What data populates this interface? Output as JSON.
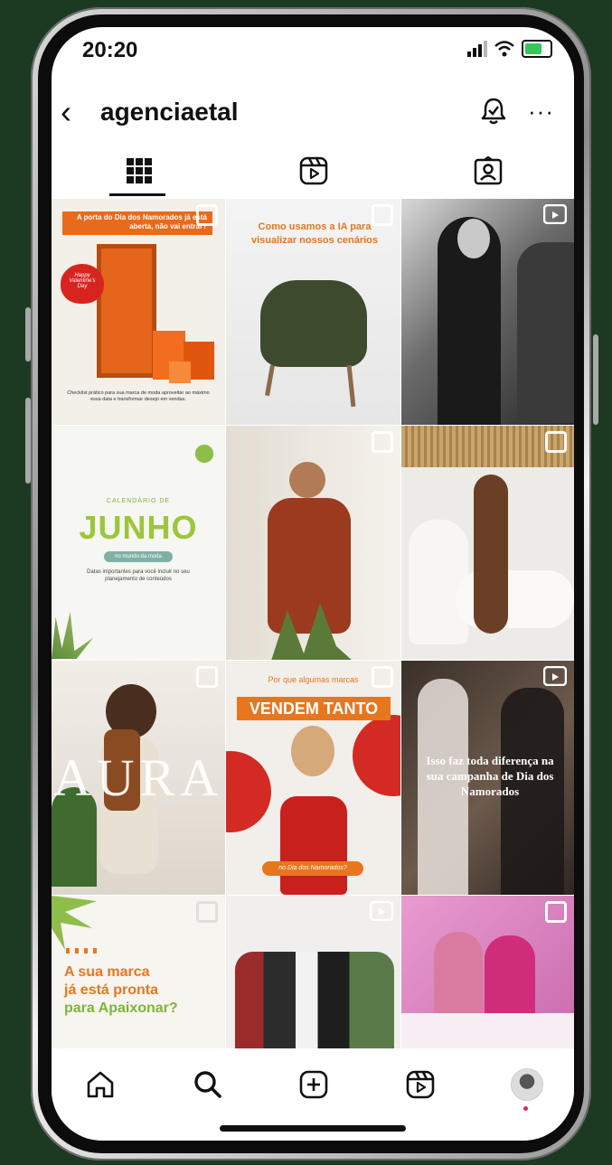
{
  "status": {
    "time": "20:20"
  },
  "header": {
    "username": "agenciaetal",
    "more": "···"
  },
  "posts": [
    {
      "banner": "A porta do Dia dos Namorados já está aberta, não vai entrar?",
      "balloon": "Happy Valentine's Day",
      "caption": "Checklist prático para sua marca de moda aproveitar ao máximo essa data e transformar desejo em vendas."
    },
    {
      "headline": "Como usamos a IA para visualizar nossos cenários"
    },
    {},
    {
      "eyebrow": "CALENDÁRIO DE",
      "title": "JUNHO",
      "pill": "no mundo da moda",
      "subtitle": "Datas importantes para você incluir no seu planejamento de conteúdos"
    },
    {},
    {},
    {
      "title": "AURA"
    },
    {
      "eyebrow": "Por que algumas marcas",
      "title": "VENDEM TANTO",
      "pill": "no Dia dos Namorados?"
    },
    {
      "text": "Isso faz toda diferença na sua campanha de Dia dos Namorados"
    },
    {
      "line1": "A sua marca",
      "line2": "já está pronta",
      "line3": "para Apaixonar?"
    },
    {},
    {}
  ]
}
